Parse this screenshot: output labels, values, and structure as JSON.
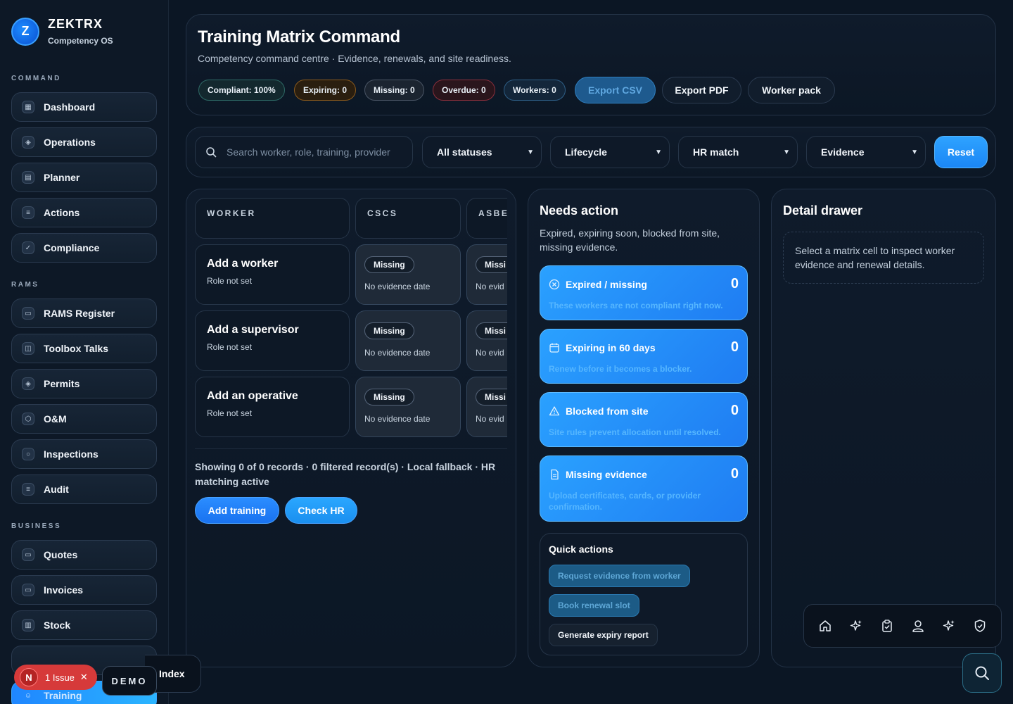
{
  "brand": {
    "name": "ZEKTRX",
    "subtitle": "Competency OS",
    "logo_letter": "Z"
  },
  "sidebar": {
    "sections": [
      {
        "label": "COMMAND",
        "items": [
          {
            "label": "Dashboard",
            "icon": "grid-icon"
          },
          {
            "label": "Operations",
            "icon": "shield-icon"
          },
          {
            "label": "Planner",
            "icon": "calendar-icon"
          },
          {
            "label": "Actions",
            "icon": "clipboard-icon"
          },
          {
            "label": "Compliance",
            "icon": "check-circle-icon"
          }
        ]
      },
      {
        "label": "RAMS",
        "items": [
          {
            "label": "RAMS Register",
            "icon": "document-icon"
          },
          {
            "label": "Toolbox Talks",
            "icon": "book-icon"
          },
          {
            "label": "Permits",
            "icon": "shield-icon"
          },
          {
            "label": "O&M",
            "icon": "box-icon"
          },
          {
            "label": "Inspections",
            "icon": "search-icon"
          },
          {
            "label": "Audit",
            "icon": "clipboard-icon"
          }
        ]
      },
      {
        "label": "BUSINESS",
        "items": [
          {
            "label": "Quotes",
            "icon": "document-icon"
          },
          {
            "label": "Invoices",
            "icon": "document-icon"
          },
          {
            "label": "Stock",
            "icon": "stack-icon"
          }
        ]
      }
    ],
    "active_item": {
      "label": "Training",
      "icon": "people-icon"
    }
  },
  "header": {
    "title": "Training Matrix Command",
    "subtitle": "Competency command centre · Evidence, renewals, and site readiness.",
    "chips": [
      {
        "label": "Compliant: 100%",
        "tone": "green"
      },
      {
        "label": "Expiring: 0",
        "tone": "amber"
      },
      {
        "label": "Missing: 0",
        "tone": "grey"
      },
      {
        "label": "Overdue: 0",
        "tone": "red"
      },
      {
        "label": "Workers: 0",
        "tone": "blue"
      }
    ],
    "buttons": {
      "export_csv": "Export CSV",
      "export_pdf": "Export PDF",
      "worker_pack": "Worker pack"
    }
  },
  "filters": {
    "search_placeholder": "Search worker, role, training, provider",
    "status": "All statuses",
    "lifecycle": "Lifecycle",
    "hr_match": "HR match",
    "evidence": "Evidence",
    "reset": "Reset"
  },
  "matrix": {
    "columns": [
      "WORKER",
      "CSCS",
      "ASBE"
    ],
    "rows": [
      {
        "name": "Add a worker",
        "role": "Role not set",
        "cells": [
          {
            "status": "Missing",
            "date": "No evidence date"
          },
          {
            "status": "Missi",
            "date": "No evid"
          }
        ]
      },
      {
        "name": "Add a supervisor",
        "role": "Role not set",
        "cells": [
          {
            "status": "Missing",
            "date": "No evidence date"
          },
          {
            "status": "Missi",
            "date": "No evid"
          }
        ]
      },
      {
        "name": "Add an operative",
        "role": "Role not set",
        "cells": [
          {
            "status": "Missing",
            "date": "No evidence date"
          },
          {
            "status": "Missi",
            "date": "No evid"
          }
        ]
      }
    ],
    "summary": "Showing 0 of 0 records · 0 filtered record(s) · Local fallback · HR matching active",
    "add_training": "Add training",
    "check_hr": "Check HR"
  },
  "needs_action": {
    "title": "Needs action",
    "subtitle": "Expired, expiring soon, blocked from site, missing evidence.",
    "alerts": [
      {
        "title": "Expired / missing",
        "count": "0",
        "desc": "These workers are not compliant right now.",
        "icon": "x-circle-icon"
      },
      {
        "title": "Expiring in 60 days",
        "count": "0",
        "desc": "Renew before it becomes a blocker.",
        "icon": "calendar-icon"
      },
      {
        "title": "Blocked from site",
        "count": "0",
        "desc": "Site rules prevent allocation until resolved.",
        "icon": "warning-icon"
      },
      {
        "title": "Missing evidence",
        "count": "0",
        "desc": "Upload certificates, cards, or provider confirmation.",
        "icon": "document-icon"
      }
    ],
    "quick_actions": {
      "title": "Quick actions",
      "request_evidence": "Request evidence from worker",
      "book_renewal": "Book renewal slot",
      "generate_report": "Generate expiry report"
    }
  },
  "detail": {
    "title": "Detail drawer",
    "hint": "Select a matrix cell to inspect worker evidence and renewal details."
  },
  "floating": {
    "issue_letter": "N",
    "issue_text": "1 Issue",
    "demo": "DEMO",
    "index": "Index",
    "dock_icons": [
      "home-icon",
      "sparkle-icon",
      "clipboard-check-icon",
      "user-badge-icon",
      "sparkle-icon",
      "shield-check-icon"
    ]
  }
}
